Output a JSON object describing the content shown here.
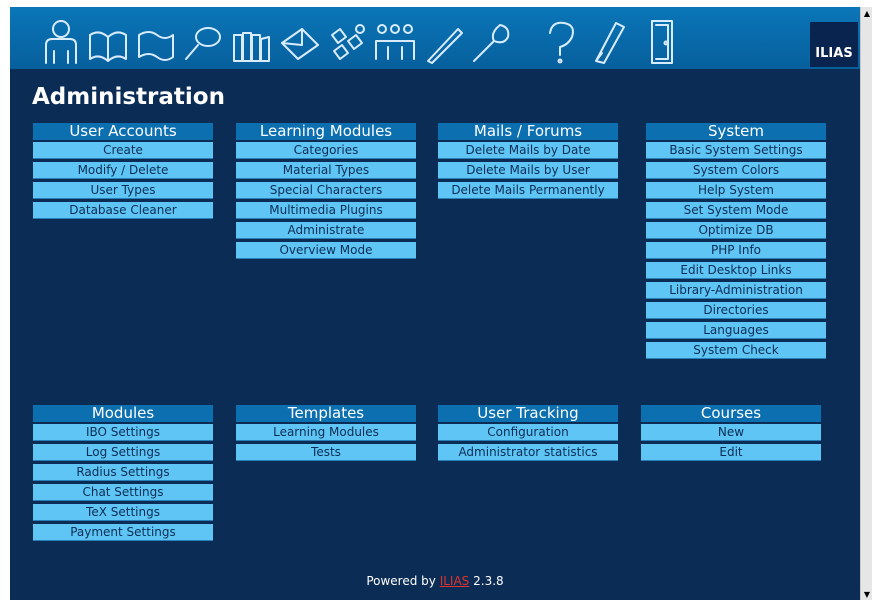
{
  "nav_icons": [
    {
      "name": "personal-desktop-icon"
    },
    {
      "name": "learning-book-icon"
    },
    {
      "name": "flag-icon"
    },
    {
      "name": "search-magnifier-icon"
    },
    {
      "name": "library-books-icon"
    },
    {
      "name": "mail-envelope-icon"
    },
    {
      "name": "groups-puzzle-icon"
    },
    {
      "name": "users-icon"
    },
    {
      "name": "editor-pen-icon"
    },
    {
      "name": "tools-wrench-icon"
    },
    {
      "name": "help-question-icon"
    },
    {
      "name": "feedback-pencil-icon"
    },
    {
      "name": "logout-door-icon"
    }
  ],
  "logo": {
    "text": "ILIAS"
  },
  "page": {
    "title": "Administration"
  },
  "sections": {
    "user_accounts": {
      "title": "User Accounts",
      "items": [
        "Create",
        "Modify / Delete",
        "User Types",
        "Database Cleaner"
      ]
    },
    "learning_modules": {
      "title": "Learning Modules",
      "items": [
        "Categories",
        "Material Types",
        "Special Characters",
        "Multimedia Plugins",
        "Administrate",
        "Overview Mode"
      ]
    },
    "mails_forums": {
      "title": "Mails / Forums",
      "items": [
        "Delete Mails by Date",
        "Delete Mails by User",
        "Delete Mails Permanently"
      ]
    },
    "system": {
      "title": "System",
      "items": [
        "Basic System Settings",
        "System Colors",
        "Help System",
        "Set System Mode",
        "Optimize DB",
        "PHP Info",
        "Edit Desktop Links",
        "Library-Administration",
        "Directories",
        "Languages",
        "System Check"
      ]
    },
    "modules": {
      "title": "Modules",
      "items": [
        "IBO Settings",
        "Log Settings",
        "Radius Settings",
        "Chat Settings",
        "TeX Settings",
        "Payment Settings"
      ]
    },
    "templates": {
      "title": "Templates",
      "items": [
        "Learning Modules",
        "Tests"
      ]
    },
    "user_tracking": {
      "title": "User Tracking",
      "items": [
        "Configuration",
        "Administrator statistics"
      ]
    },
    "courses": {
      "title": "Courses",
      "items": [
        "New",
        "Edit"
      ]
    }
  },
  "footer": {
    "prefix": "Powered by",
    "link": "ILIAS",
    "version": "2.3.8"
  }
}
